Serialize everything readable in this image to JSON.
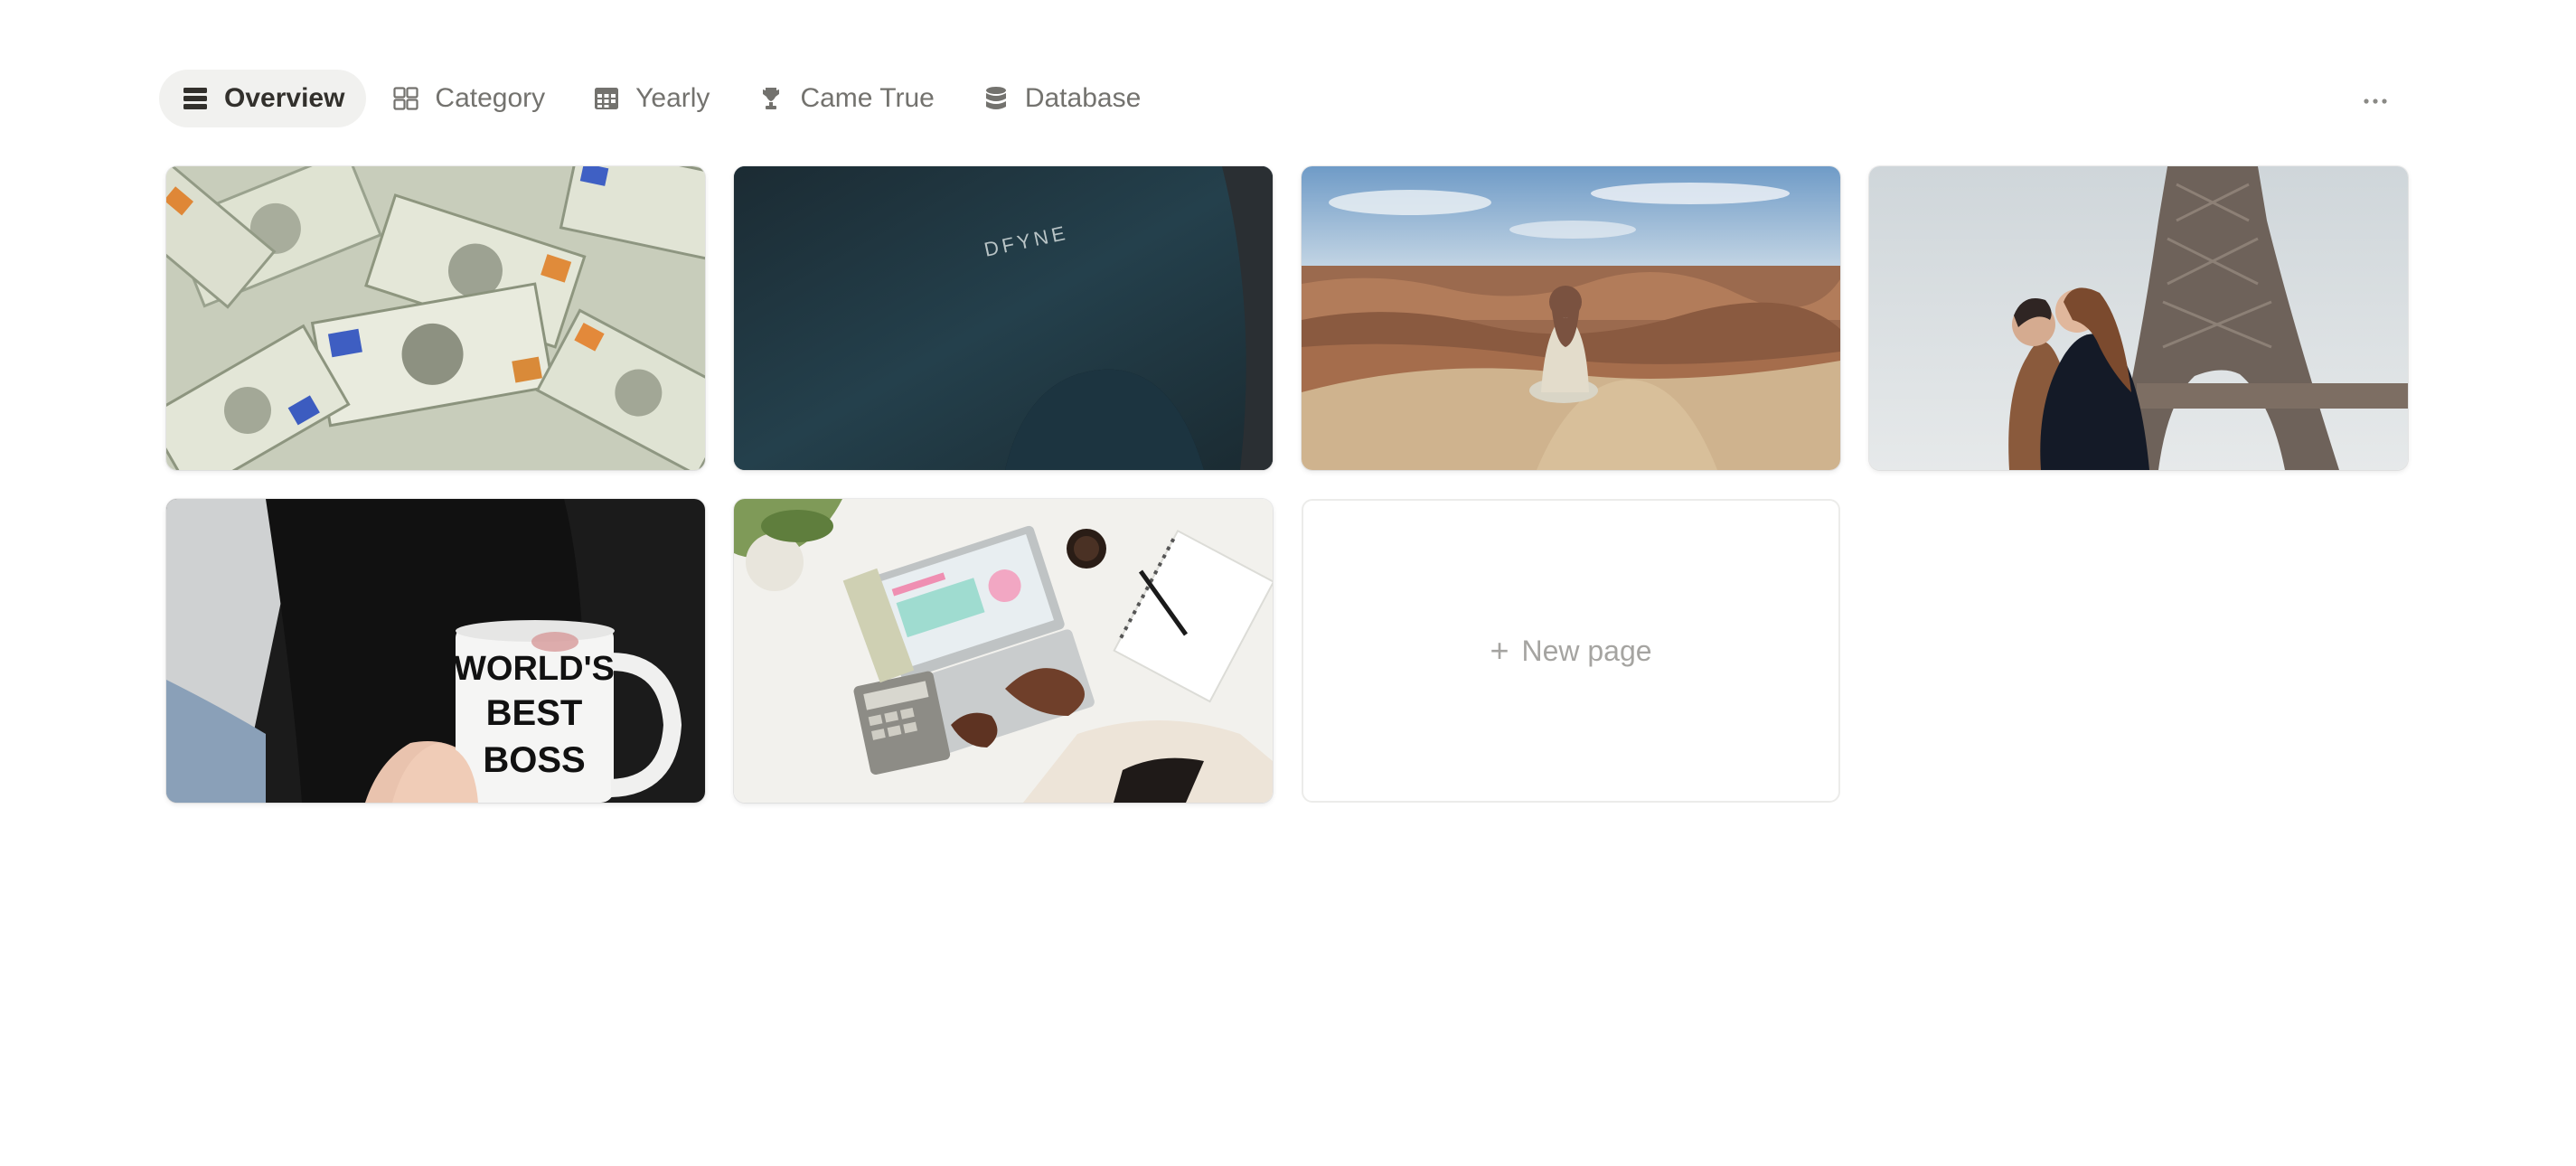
{
  "tabs": [
    {
      "label": "Overview",
      "icon": "table-list-icon",
      "active": true
    },
    {
      "label": "Category",
      "icon": "gallery-grid-icon",
      "active": false
    },
    {
      "label": "Yearly",
      "icon": "calendar-grid-icon",
      "active": false
    },
    {
      "label": "Came True",
      "icon": "trophy-icon",
      "active": false
    },
    {
      "label": "Database",
      "icon": "database-icon",
      "active": false
    }
  ],
  "more": {
    "icon": "more-horizontal-icon"
  },
  "cards": [
    {
      "cover": "money-dollar-bills"
    },
    {
      "cover": "athletic-leggings",
      "overlay_text": "DFYNE"
    },
    {
      "cover": "grand-canyon-meditation"
    },
    {
      "cover": "eiffel-tower-couple"
    },
    {
      "cover": "worlds-best-boss-mug",
      "overlay_text": [
        "WORLD'S",
        "BEST",
        "BOSS"
      ]
    },
    {
      "cover": "laptop-desk-finance"
    }
  ],
  "new_page": {
    "label": "New page",
    "icon": "plus-icon"
  },
  "colors": {
    "active_tab_bg": "#f1f1ef",
    "tab_text": "#73726e",
    "active_tab_text": "#32302c",
    "new_page_text": "#a5a4a1"
  }
}
